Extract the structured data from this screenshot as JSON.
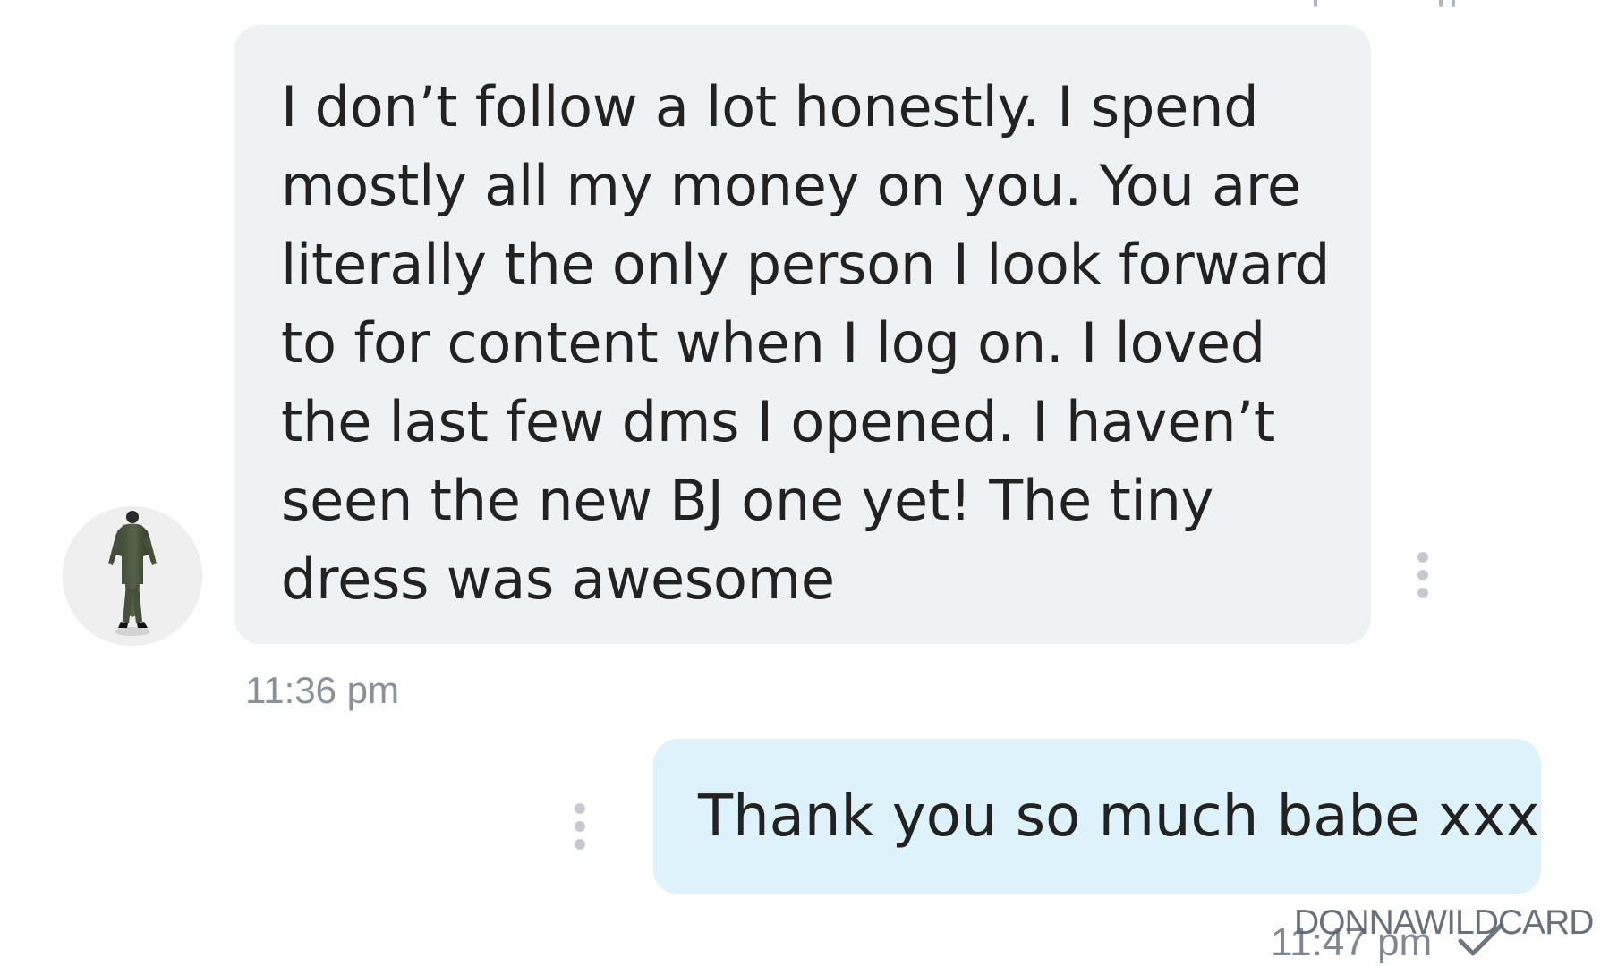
{
  "conversation": {
    "incoming_message": {
      "text": "I don’t follow a lot honestly. I spend\nmostly all my money on you. You are\nliterally the only person I look forward\nto for content when I log on. I loved\nthe last few dms I opened. I haven’t\nseen the new BJ one yet! The tiny\ndress was awesome",
      "time": "11:36 pm"
    },
    "outgoing_message": {
      "text": "Thank you so much babe xxx",
      "time": "11:47 pm"
    }
  },
  "icons": {
    "avatar": "user-avatar-icon",
    "incoming_menu": "more-vert-icon",
    "outgoing_menu": "more-vert-icon",
    "read_status": "check-icon",
    "top_fragment": "cropped-status-icon"
  },
  "watermark": {
    "text": "DONNAWILDCARD"
  },
  "colors": {
    "incoming_bubble": "#eff2f5",
    "outgoing_bubble": "#def2fb",
    "timestamp": "#8a9098",
    "menu_dots": "#c6c9ce"
  }
}
